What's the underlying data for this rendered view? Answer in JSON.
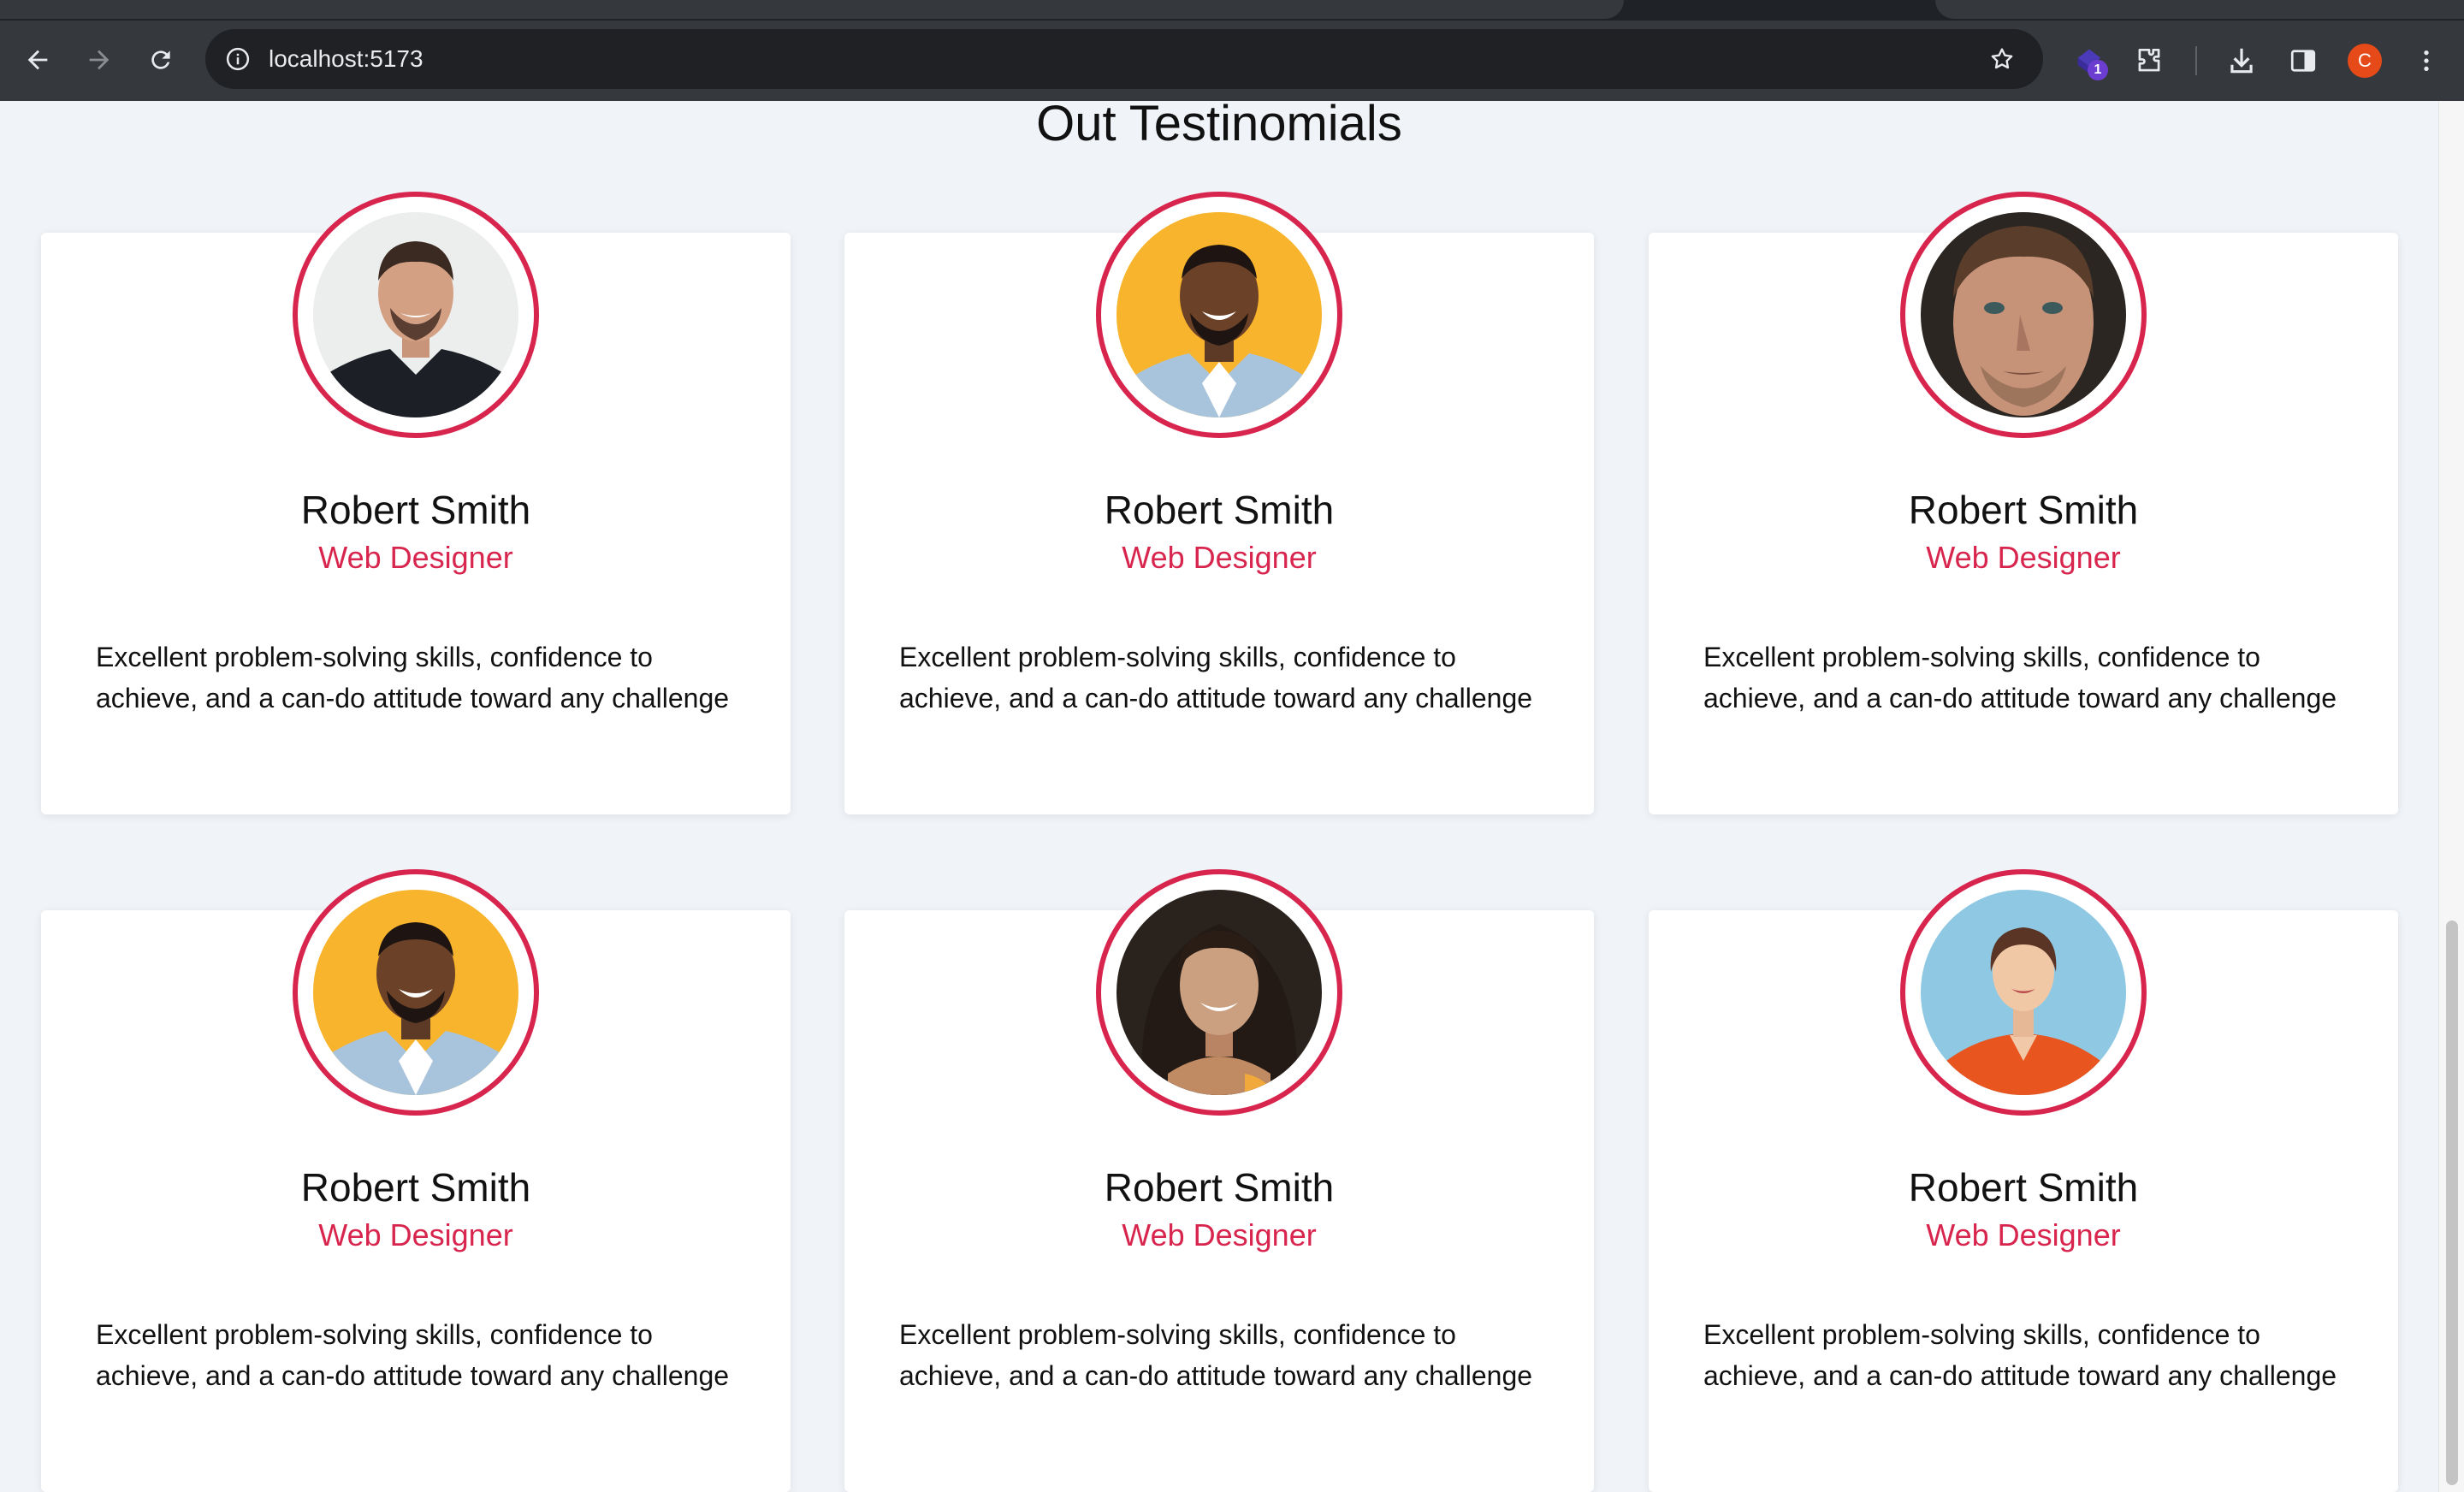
{
  "browser": {
    "url": "localhost:5173",
    "extension_badge": "1",
    "profile_initial": "C"
  },
  "page": {
    "heading": "Out Testinomials",
    "testimonials": [
      {
        "name": "Robert Smith",
        "role": "Web Designer",
        "quote": "Excellent problem-solving skills, confidence to achieve, and a can-do attitude toward any challenge"
      },
      {
        "name": "Robert Smith",
        "role": "Web Designer",
        "quote": "Excellent problem-solving skills, confidence to achieve, and a can-do attitude toward any challenge"
      },
      {
        "name": "Robert Smith",
        "role": "Web Designer",
        "quote": "Excellent problem-solving skills, confidence to achieve, and a can-do attitude toward any challenge"
      },
      {
        "name": "Robert Smith",
        "role": "Web Designer",
        "quote": "Excellent problem-solving skills, confidence to achieve, and a can-do attitude toward any challenge"
      },
      {
        "name": "Robert Smith",
        "role": "Web Designer",
        "quote": "Excellent problem-solving skills, confidence to achieve, and a can-do attitude toward any challenge"
      },
      {
        "name": "Robert Smith",
        "role": "Web Designer",
        "quote": "Excellent problem-solving skills, confidence to achieve, and a can-do attitude toward any challenge"
      }
    ]
  },
  "colors": {
    "accent": "#d8254e",
    "page_bg": "#f0f3f8",
    "chrome_bg": "#35383d"
  },
  "icons": [
    "back-arrow-icon",
    "forward-arrow-icon",
    "reload-icon",
    "site-info-icon",
    "bookmark-star-icon",
    "extension-icon",
    "puzzle-icon",
    "download-icon",
    "side-panel-icon",
    "menu-dots-icon"
  ]
}
